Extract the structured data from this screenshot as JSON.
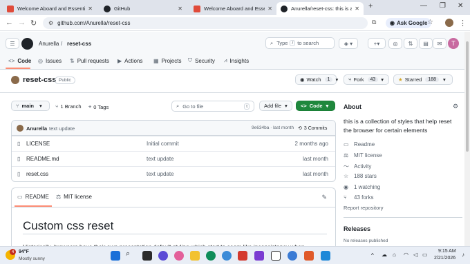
{
  "browser": {
    "tabs": [
      {
        "title": "Welcome Aboard and Essentia"
      },
      {
        "title": "GitHub"
      },
      {
        "title": "Welcome Aboard and Essentia"
      },
      {
        "title": "Anurella/reset-css: this is a collec"
      }
    ],
    "new_tab": "+",
    "win_controls": {
      "minimize": "—",
      "restore": "❐",
      "close": "✕"
    },
    "url": "github.com/Anurella/reset-css",
    "ask_google": "Ask Google"
  },
  "gh_header": {
    "owner": "Anurella",
    "sep": "/",
    "repo": "reset-css",
    "search_placeholder_pre": "Type",
    "search_key": "/",
    "search_placeholder_post": "to search",
    "plus": "+"
  },
  "repo_nav": [
    {
      "label": "Code",
      "icon": "<>"
    },
    {
      "label": "Issues",
      "icon": "◎"
    },
    {
      "label": "Pull requests",
      "icon": "⇅"
    },
    {
      "label": "Actions",
      "icon": "▶"
    },
    {
      "label": "Projects",
      "icon": "▦"
    },
    {
      "label": "Security",
      "icon": "⛉"
    },
    {
      "label": "Insights",
      "icon": "📈"
    }
  ],
  "repo": {
    "name": "reset-css",
    "visibility": "Public",
    "watch_label": "Watch",
    "watch_count": "1",
    "fork_label": "Fork",
    "fork_count": "43",
    "star_label": "Starred",
    "star_count": "188"
  },
  "toolbar": {
    "branch": "main",
    "branches": "1 Branch",
    "tags": "0 Tags",
    "goto_placeholder": "Go to file",
    "goto_key": "t",
    "add_file": "Add file",
    "code": "Code"
  },
  "commit": {
    "author": "Anurella",
    "message": "text update",
    "hash_time": "9e634ba · last month",
    "commits": "3 Commits"
  },
  "files": [
    {
      "name": "LICENSE",
      "message": "Initial commit",
      "time": "2 months ago"
    },
    {
      "name": "README.md",
      "message": "text update",
      "time": "last month"
    },
    {
      "name": "reset.css",
      "message": "text update",
      "time": "last month"
    }
  ],
  "readme": {
    "tab_readme": "README",
    "tab_license": "MIT license",
    "heading": "Custom css reset",
    "body": "Historically, browsers have their own presentation default styling which start to seem like inconsistency when"
  },
  "about": {
    "title": "About",
    "description": "this is a collection of styles that help reset the browser for certain elements",
    "items": [
      {
        "label": "Readme",
        "icon": "📖"
      },
      {
        "label": "MIT license",
        "icon": "⚖"
      },
      {
        "label": "Activity",
        "icon": "〜"
      },
      {
        "label": "188 stars",
        "icon": "☆"
      },
      {
        "label": "1 watching",
        "icon": "◉"
      },
      {
        "label": "43 forks",
        "icon": "⑂"
      }
    ],
    "report": "Report repository",
    "releases_title": "Releases",
    "releases_text": "No releases published"
  },
  "taskbar": {
    "temp": "94°F",
    "weather": "Mostly sunny",
    "badge": "4",
    "time": "9:15 AM",
    "date": "2/21/2026"
  },
  "colors": {
    "accent_green": "#1f883d",
    "tab_underline": "#fd8c73",
    "link_blue": "#0969da"
  }
}
